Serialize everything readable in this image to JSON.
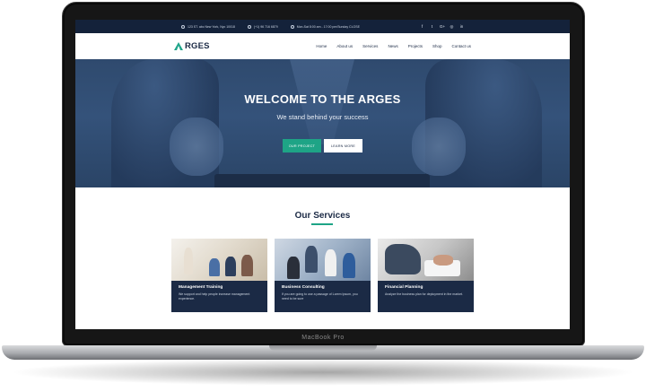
{
  "device": {
    "brand_label": "MacBook Pro"
  },
  "topbar": {
    "address": "123 ST. abc New York, Nyc 10018",
    "phone": "(+1) 96 716 6879",
    "hours": "Mon-Sat 8:00 am - 17:00 pm/Sunday CLOSE",
    "socials": [
      {
        "icon": "facebook-icon",
        "glyph": "f"
      },
      {
        "icon": "twitter-icon",
        "glyph": "t"
      },
      {
        "icon": "google-plus-icon",
        "glyph": "G+"
      },
      {
        "icon": "instagram-icon",
        "glyph": "◎"
      },
      {
        "icon": "linkedin-icon",
        "glyph": "in"
      }
    ]
  },
  "nav": {
    "logo_text": "RGES",
    "menu": [
      "Home",
      "About us",
      "Services",
      "News",
      "Projects",
      "Shop",
      "Contact us"
    ]
  },
  "hero": {
    "title": "WELCOME TO THE ARGES",
    "subtitle": "We stand behind your success",
    "primary_button": "Our Project",
    "secondary_button": "Learn More"
  },
  "services": {
    "title": "Our Services",
    "cards": [
      {
        "title": "Management Training",
        "text": "We support and help people increase management experience."
      },
      {
        "title": "Business Consulting",
        "text": "If you are going to use a passage of Lorem Ipsum, you need to be sure"
      },
      {
        "title": "Financial Planning",
        "text": "Analyze the business plan for deployment in the market."
      }
    ]
  },
  "colors": {
    "topbar": "#14223a",
    "hero": "#34527a",
    "accent": "#1ea486",
    "card": "#1b2a45"
  }
}
